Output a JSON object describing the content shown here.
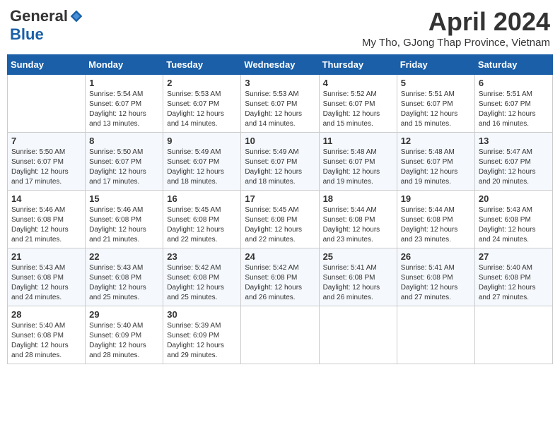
{
  "logo": {
    "general": "General",
    "blue": "Blue"
  },
  "title": "April 2024",
  "location": "My Tho, GJong Thap Province, Vietnam",
  "days_of_week": [
    "Sunday",
    "Monday",
    "Tuesday",
    "Wednesday",
    "Thursday",
    "Friday",
    "Saturday"
  ],
  "weeks": [
    [
      {
        "day": "",
        "info": ""
      },
      {
        "day": "1",
        "info": "Sunrise: 5:54 AM\nSunset: 6:07 PM\nDaylight: 12 hours\nand 13 minutes."
      },
      {
        "day": "2",
        "info": "Sunrise: 5:53 AM\nSunset: 6:07 PM\nDaylight: 12 hours\nand 14 minutes."
      },
      {
        "day": "3",
        "info": "Sunrise: 5:53 AM\nSunset: 6:07 PM\nDaylight: 12 hours\nand 14 minutes."
      },
      {
        "day": "4",
        "info": "Sunrise: 5:52 AM\nSunset: 6:07 PM\nDaylight: 12 hours\nand 15 minutes."
      },
      {
        "day": "5",
        "info": "Sunrise: 5:51 AM\nSunset: 6:07 PM\nDaylight: 12 hours\nand 15 minutes."
      },
      {
        "day": "6",
        "info": "Sunrise: 5:51 AM\nSunset: 6:07 PM\nDaylight: 12 hours\nand 16 minutes."
      }
    ],
    [
      {
        "day": "7",
        "info": "Sunrise: 5:50 AM\nSunset: 6:07 PM\nDaylight: 12 hours\nand 17 minutes."
      },
      {
        "day": "8",
        "info": "Sunrise: 5:50 AM\nSunset: 6:07 PM\nDaylight: 12 hours\nand 17 minutes."
      },
      {
        "day": "9",
        "info": "Sunrise: 5:49 AM\nSunset: 6:07 PM\nDaylight: 12 hours\nand 18 minutes."
      },
      {
        "day": "10",
        "info": "Sunrise: 5:49 AM\nSunset: 6:07 PM\nDaylight: 12 hours\nand 18 minutes."
      },
      {
        "day": "11",
        "info": "Sunrise: 5:48 AM\nSunset: 6:07 PM\nDaylight: 12 hours\nand 19 minutes."
      },
      {
        "day": "12",
        "info": "Sunrise: 5:48 AM\nSunset: 6:07 PM\nDaylight: 12 hours\nand 19 minutes."
      },
      {
        "day": "13",
        "info": "Sunrise: 5:47 AM\nSunset: 6:07 PM\nDaylight: 12 hours\nand 20 minutes."
      }
    ],
    [
      {
        "day": "14",
        "info": "Sunrise: 5:46 AM\nSunset: 6:08 PM\nDaylight: 12 hours\nand 21 minutes."
      },
      {
        "day": "15",
        "info": "Sunrise: 5:46 AM\nSunset: 6:08 PM\nDaylight: 12 hours\nand 21 minutes."
      },
      {
        "day": "16",
        "info": "Sunrise: 5:45 AM\nSunset: 6:08 PM\nDaylight: 12 hours\nand 22 minutes."
      },
      {
        "day": "17",
        "info": "Sunrise: 5:45 AM\nSunset: 6:08 PM\nDaylight: 12 hours\nand 22 minutes."
      },
      {
        "day": "18",
        "info": "Sunrise: 5:44 AM\nSunset: 6:08 PM\nDaylight: 12 hours\nand 23 minutes."
      },
      {
        "day": "19",
        "info": "Sunrise: 5:44 AM\nSunset: 6:08 PM\nDaylight: 12 hours\nand 23 minutes."
      },
      {
        "day": "20",
        "info": "Sunrise: 5:43 AM\nSunset: 6:08 PM\nDaylight: 12 hours\nand 24 minutes."
      }
    ],
    [
      {
        "day": "21",
        "info": "Sunrise: 5:43 AM\nSunset: 6:08 PM\nDaylight: 12 hours\nand 24 minutes."
      },
      {
        "day": "22",
        "info": "Sunrise: 5:43 AM\nSunset: 6:08 PM\nDaylight: 12 hours\nand 25 minutes."
      },
      {
        "day": "23",
        "info": "Sunrise: 5:42 AM\nSunset: 6:08 PM\nDaylight: 12 hours\nand 25 minutes."
      },
      {
        "day": "24",
        "info": "Sunrise: 5:42 AM\nSunset: 6:08 PM\nDaylight: 12 hours\nand 26 minutes."
      },
      {
        "day": "25",
        "info": "Sunrise: 5:41 AM\nSunset: 6:08 PM\nDaylight: 12 hours\nand 26 minutes."
      },
      {
        "day": "26",
        "info": "Sunrise: 5:41 AM\nSunset: 6:08 PM\nDaylight: 12 hours\nand 27 minutes."
      },
      {
        "day": "27",
        "info": "Sunrise: 5:40 AM\nSunset: 6:08 PM\nDaylight: 12 hours\nand 27 minutes."
      }
    ],
    [
      {
        "day": "28",
        "info": "Sunrise: 5:40 AM\nSunset: 6:08 PM\nDaylight: 12 hours\nand 28 minutes."
      },
      {
        "day": "29",
        "info": "Sunrise: 5:40 AM\nSunset: 6:09 PM\nDaylight: 12 hours\nand 28 minutes."
      },
      {
        "day": "30",
        "info": "Sunrise: 5:39 AM\nSunset: 6:09 PM\nDaylight: 12 hours\nand 29 minutes."
      },
      {
        "day": "",
        "info": ""
      },
      {
        "day": "",
        "info": ""
      },
      {
        "day": "",
        "info": ""
      },
      {
        "day": "",
        "info": ""
      }
    ]
  ]
}
